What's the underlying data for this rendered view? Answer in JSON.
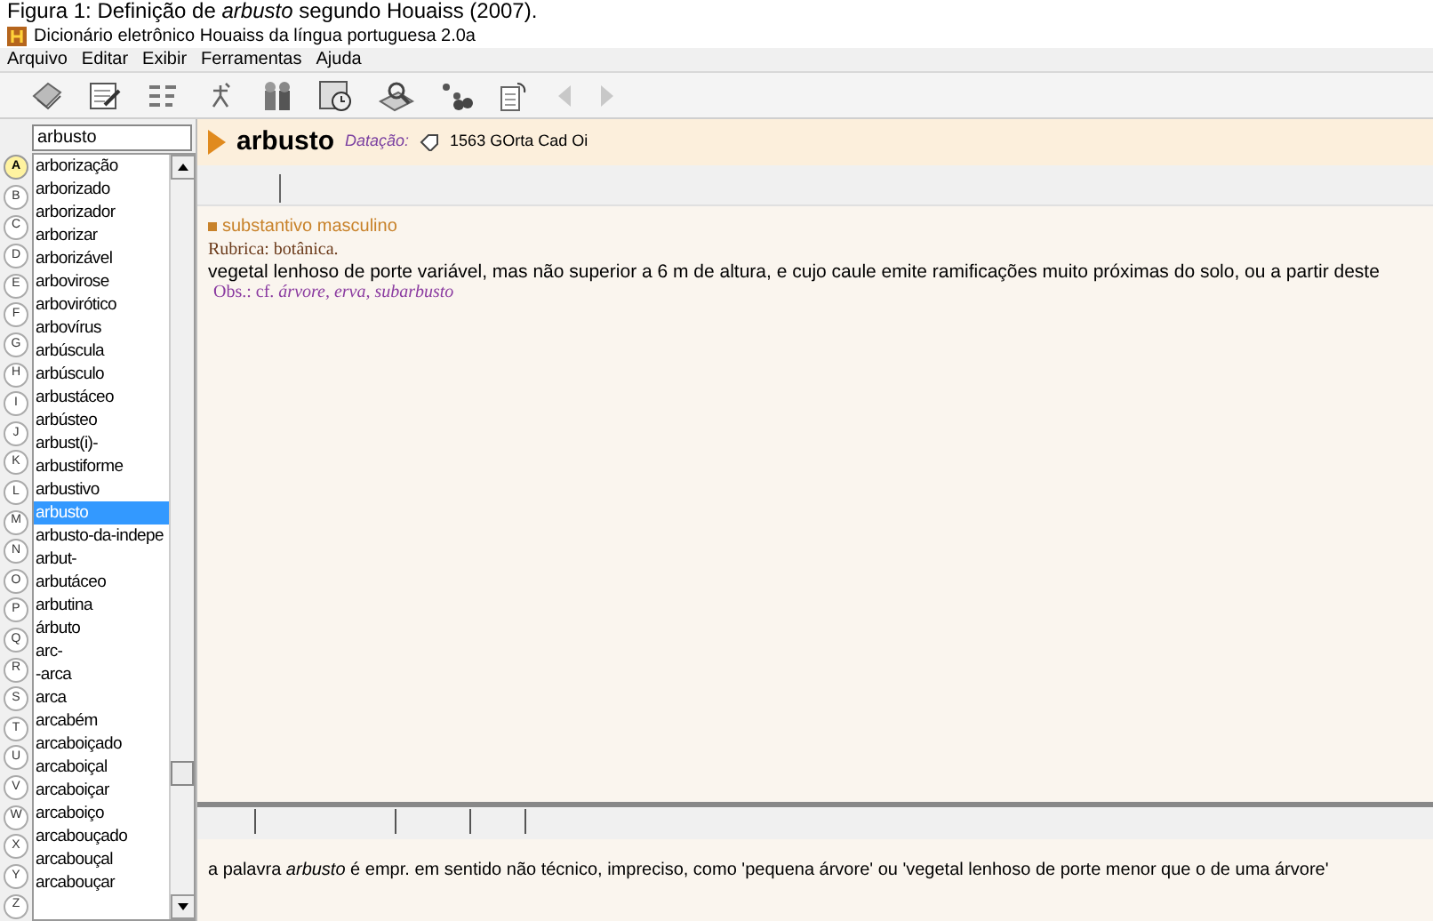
{
  "caption": "Figura 1: Definição de *arbusto* segundo Houaiss (2007).",
  "window": {
    "title": "Dicionário eletrônico Houaiss da língua portuguesa 2.0a"
  },
  "menu": [
    "Arquivo",
    "Editar",
    "Exibir",
    "Ferramentas",
    "Ajuda"
  ],
  "search": {
    "value": "arbusto"
  },
  "letters": [
    {
      "label": "A",
      "selected": true
    },
    {
      "label": "B",
      "selected": false
    },
    {
      "label": "C",
      "selected": false
    },
    {
      "label": "D",
      "selected": false
    },
    {
      "label": "E",
      "selected": false
    },
    {
      "label": "F",
      "selected": false
    },
    {
      "label": "G",
      "selected": false
    },
    {
      "label": "H",
      "selected": false
    },
    {
      "label": "I",
      "selected": false
    },
    {
      "label": "J",
      "selected": false
    },
    {
      "label": "K",
      "selected": false
    },
    {
      "label": "L",
      "selected": false
    },
    {
      "label": "M",
      "selected": false
    },
    {
      "label": "N",
      "selected": false
    },
    {
      "label": "O",
      "selected": false
    },
    {
      "label": "P",
      "selected": false
    },
    {
      "label": "Q",
      "selected": false
    },
    {
      "label": "R",
      "selected": false
    },
    {
      "label": "S",
      "selected": false
    },
    {
      "label": "T",
      "selected": false
    },
    {
      "label": "U",
      "selected": false
    },
    {
      "label": "V",
      "selected": false
    },
    {
      "label": "W",
      "selected": false
    },
    {
      "label": "X",
      "selected": false
    },
    {
      "label": "Y",
      "selected": false
    },
    {
      "label": "Z",
      "selected": false
    }
  ],
  "words": [
    {
      "label": "arborização",
      "selected": false
    },
    {
      "label": "arborizado",
      "selected": false
    },
    {
      "label": "arborizador",
      "selected": false
    },
    {
      "label": "arborizar",
      "selected": false
    },
    {
      "label": "arborizável",
      "selected": false
    },
    {
      "label": "arbovirose",
      "selected": false
    },
    {
      "label": "arbovirótico",
      "selected": false
    },
    {
      "label": "arbovírus",
      "selected": false
    },
    {
      "label": "arbúscula",
      "selected": false
    },
    {
      "label": "arbúsculo",
      "selected": false
    },
    {
      "label": "arbustáceo",
      "selected": false
    },
    {
      "label": "arbústeo",
      "selected": false
    },
    {
      "label": "arbust(i)-",
      "selected": false
    },
    {
      "label": "arbustiforme",
      "selected": false
    },
    {
      "label": "arbustivo",
      "selected": false
    },
    {
      "label": "arbusto",
      "selected": true
    },
    {
      "label": "arbusto-da-indepe",
      "selected": false
    },
    {
      "label": "arbut-",
      "selected": false
    },
    {
      "label": "arbutáceo",
      "selected": false
    },
    {
      "label": "arbutina",
      "selected": false
    },
    {
      "label": "árbuto",
      "selected": false
    },
    {
      "label": "arc-",
      "selected": false
    },
    {
      "label": "-arca",
      "selected": false
    },
    {
      "label": "arca",
      "selected": false
    },
    {
      "label": "arcabém",
      "selected": false
    },
    {
      "label": "arcaboiçado",
      "selected": false
    },
    {
      "label": "arcaboiçal",
      "selected": false
    },
    {
      "label": "arcaboiçar",
      "selected": false
    },
    {
      "label": "arcaboiço",
      "selected": false
    },
    {
      "label": "arcabouçado",
      "selected": false
    },
    {
      "label": "arcabouçal",
      "selected": false
    },
    {
      "label": "arcabouçar",
      "selected": false
    }
  ],
  "entry": {
    "headword": "arbusto",
    "dating_label": "Datação:",
    "dating": "1563 GOrta Cad Oi",
    "part_of_speech": "substantivo masculino",
    "rubric": "Rubrica: botânica.",
    "definition": "vegetal lenhoso de porte variável, mas não superior a 6 m de altura, e cujo caule emite ramificações muito próximas do solo, ou a partir deste",
    "obs": "Obs.: cf. *árvore, erva, subarbusto*"
  },
  "note": "a palavra *arbusto* é empr. em sentido não técnico, impreciso, como 'pequena árvore' ou 'vegetal lenhoso de porte menor que o de uma árvore'"
}
